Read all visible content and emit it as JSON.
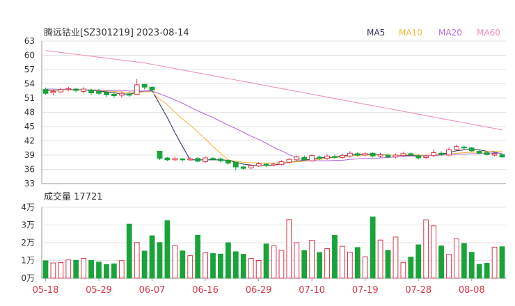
{
  "header": {
    "title": "腾远钴业[SZ301219] 2023-08-14"
  },
  "legend": [
    {
      "label": "MA5",
      "color": "#333366"
    },
    {
      "label": "MA10",
      "color": "#f5b942"
    },
    {
      "label": "MA20",
      "color": "#b56ee0"
    },
    {
      "label": "MA60",
      "color": "#f090c0"
    }
  ],
  "volume_label": "成交量 17721",
  "colors": {
    "up": "#d9344a",
    "down": "#1aa33a",
    "grid": "#e3e3e3",
    "axis": "#555555",
    "date": "#d9344a"
  },
  "chart_data": [
    {
      "type": "candlestick",
      "title": "腾远钴业[SZ301219] 2023-08-14",
      "ylim": [
        33,
        63
      ],
      "yticks": [
        "63",
        "60",
        "57",
        "54",
        "51",
        "48",
        "45",
        "42",
        "39",
        "36",
        "33"
      ],
      "x": [
        "05-18",
        "05-19",
        "05-22",
        "05-23",
        "05-24",
        "05-25",
        "05-26",
        "05-29",
        "05-30",
        "05-31",
        "06-01",
        "06-02",
        "06-05",
        "06-06",
        "06-07",
        "06-08",
        "06-09",
        "06-12",
        "06-13",
        "06-14",
        "06-15",
        "06-16",
        "06-19",
        "06-20",
        "06-21",
        "06-26",
        "06-27",
        "06-28",
        "06-29",
        "06-30",
        "07-03",
        "07-04",
        "07-05",
        "07-06",
        "07-07",
        "07-10",
        "07-11",
        "07-12",
        "07-13",
        "07-14",
        "07-17",
        "07-18",
        "07-19",
        "07-20",
        "07-21",
        "07-24",
        "07-25",
        "07-26",
        "07-27",
        "07-28",
        "07-31",
        "08-01",
        "08-02",
        "08-03",
        "08-04",
        "08-07",
        "08-08",
        "08-09",
        "08-10",
        "08-11",
        "08-14"
      ],
      "xtick_labels": [
        "05-18",
        "05-29",
        "06-07",
        "06-16",
        "06-29",
        "07-10",
        "07-19",
        "07-28",
        "08-08"
      ],
      "xtick_index": [
        0,
        7,
        14,
        21,
        28,
        35,
        42,
        49,
        56
      ],
      "candles": [
        [
          52.8,
          52.0,
          53.2,
          51.7
        ],
        [
          52.1,
          52.4,
          52.8,
          51.6
        ],
        [
          52.3,
          52.8,
          53.2,
          52.1
        ],
        [
          52.8,
          53.0,
          53.4,
          52.5
        ],
        [
          52.9,
          52.6,
          53.1,
          52.2
        ],
        [
          52.4,
          52.9,
          53.3,
          52.0
        ],
        [
          52.7,
          52.1,
          53.0,
          51.6
        ],
        [
          52.4,
          52.0,
          52.9,
          51.6
        ],
        [
          52.2,
          51.7,
          52.5,
          51.2
        ],
        [
          51.8,
          51.5,
          52.3,
          51.1
        ],
        [
          51.6,
          52.0,
          52.4,
          51.1
        ],
        [
          51.9,
          51.6,
          52.3,
          51.2
        ],
        [
          51.8,
          53.8,
          55.0,
          51.8
        ],
        [
          53.9,
          53.3,
          54.0,
          52.8
        ],
        [
          53.3,
          52.7,
          53.5,
          52.2
        ],
        [
          39.8,
          38.3,
          39.8,
          38.0
        ],
        [
          38.4,
          38.0,
          38.6,
          37.7
        ],
        [
          38.0,
          38.3,
          38.7,
          37.8
        ],
        [
          38.2,
          38.0,
          38.4,
          37.7
        ],
        [
          38.0,
          38.2,
          38.5,
          37.8
        ],
        [
          38.3,
          37.7,
          38.6,
          37.5
        ],
        [
          37.6,
          38.4,
          38.7,
          37.3
        ],
        [
          38.3,
          38.1,
          38.6,
          37.9
        ],
        [
          38.2,
          37.8,
          38.5,
          37.4
        ],
        [
          37.9,
          37.3,
          38.1,
          37.0
        ],
        [
          37.5,
          36.5,
          37.6,
          35.8
        ],
        [
          36.5,
          36.2,
          36.8,
          35.9
        ],
        [
          36.3,
          36.8,
          37.0,
          36.0
        ],
        [
          36.7,
          37.2,
          37.5,
          36.5
        ],
        [
          37.1,
          36.8,
          37.3,
          36.5
        ],
        [
          36.9,
          37.1,
          37.4,
          36.6
        ],
        [
          37.0,
          37.6,
          37.9,
          36.8
        ],
        [
          37.5,
          38.1,
          38.4,
          37.2
        ],
        [
          38.0,
          38.6,
          38.9,
          37.7
        ],
        [
          38.5,
          38.0,
          38.9,
          37.8
        ],
        [
          37.8,
          38.9,
          39.2,
          37.6
        ],
        [
          38.6,
          38.3,
          38.9,
          38.0
        ],
        [
          38.3,
          38.8,
          39.2,
          38.0
        ],
        [
          38.7,
          38.5,
          39.1,
          38.2
        ],
        [
          38.5,
          38.9,
          39.3,
          38.2
        ],
        [
          38.8,
          39.4,
          39.8,
          38.5
        ],
        [
          39.3,
          39.0,
          39.6,
          38.7
        ],
        [
          39.0,
          39.3,
          39.7,
          38.7
        ],
        [
          39.4,
          38.8,
          39.6,
          38.5
        ],
        [
          38.8,
          39.1,
          39.5,
          38.5
        ],
        [
          39.0,
          38.6,
          39.4,
          38.3
        ],
        [
          38.6,
          39.0,
          39.3,
          38.3
        ],
        [
          38.9,
          39.3,
          39.7,
          38.6
        ],
        [
          39.3,
          39.0,
          39.6,
          38.7
        ],
        [
          38.9,
          38.4,
          39.2,
          38.1
        ],
        [
          38.5,
          38.8,
          39.1,
          38.2
        ],
        [
          38.9,
          39.5,
          40.2,
          38.6
        ],
        [
          39.4,
          39.1,
          39.8,
          38.8
        ],
        [
          39.0,
          40.1,
          40.6,
          38.8
        ],
        [
          40.2,
          40.8,
          41.2,
          39.8
        ],
        [
          40.7,
          40.5,
          41.0,
          40.2
        ],
        [
          40.5,
          39.9,
          40.7,
          39.6
        ],
        [
          39.8,
          39.4,
          40.1,
          39.2
        ],
        [
          39.5,
          39.1,
          39.7,
          38.9
        ],
        [
          39.0,
          39.3,
          39.6,
          38.7
        ],
        [
          39.1,
          38.6,
          39.3,
          38.4
        ]
      ],
      "ma": {
        "MA5": [
          52.6,
          52.6,
          52.7,
          52.7,
          52.7,
          52.7,
          52.6,
          52.5,
          52.3,
          52.1,
          51.9,
          51.8,
          52.2,
          52.5,
          52.6,
          49.7,
          46.9,
          43.7,
          40.8,
          38.0,
          38.0,
          38.0,
          38.0,
          38.0,
          37.9,
          37.5,
          37.1,
          36.9,
          36.8,
          36.8,
          36.9,
          37.2,
          37.5,
          37.7,
          37.9,
          38.2,
          38.4,
          38.5,
          38.6,
          38.8,
          39.0,
          39.1,
          39.2,
          39.1,
          39.1,
          39.0,
          39.0,
          38.9,
          38.9,
          38.9,
          38.9,
          39.0,
          39.2,
          39.5,
          39.9,
          40.1,
          40.2,
          40.1,
          39.8,
          39.6,
          39.3
        ],
        "MA10": [
          52.7,
          52.7,
          52.7,
          52.7,
          52.7,
          52.7,
          52.7,
          52.6,
          52.5,
          52.4,
          52.3,
          52.2,
          52.2,
          52.3,
          52.3,
          50.7,
          49.6,
          48.0,
          46.6,
          45.3,
          43.9,
          42.4,
          40.8,
          39.4,
          38.0,
          37.7,
          37.5,
          37.4,
          37.3,
          37.3,
          37.3,
          37.4,
          37.5,
          37.6,
          37.7,
          37.9,
          38.1,
          38.3,
          38.5,
          38.6,
          38.8,
          38.9,
          39.0,
          39.0,
          39.0,
          39.0,
          39.0,
          39.0,
          39.1,
          39.0,
          39.0,
          39.0,
          39.1,
          39.2,
          39.4,
          39.5,
          39.6,
          39.6,
          39.7,
          39.8,
          39.8
        ],
        "MA20": [
          52.9,
          52.9,
          52.8,
          52.8,
          52.8,
          52.8,
          52.7,
          52.7,
          52.6,
          52.6,
          52.6,
          52.5,
          52.5,
          52.5,
          52.5,
          51.9,
          51.3,
          50.6,
          49.9,
          49.1,
          48.3,
          47.6,
          46.9,
          46.1,
          45.3,
          44.6,
          43.8,
          43.0,
          42.3,
          41.5,
          40.6,
          39.9,
          39.1,
          38.5,
          37.9,
          37.8,
          37.8,
          37.8,
          37.9,
          37.9,
          38.1,
          38.2,
          38.3,
          38.3,
          38.4,
          38.5,
          38.6,
          38.7,
          38.8,
          38.8,
          38.9,
          38.9,
          39.0,
          39.1,
          39.2,
          39.2,
          39.3,
          39.3,
          39.4,
          39.4,
          39.4
        ],
        "MA60": [
          61.0,
          60.8,
          60.6,
          60.4,
          60.2,
          60.0,
          59.8,
          59.6,
          59.4,
          59.2,
          59.0,
          58.8,
          58.6,
          58.4,
          58.1,
          57.8,
          57.5,
          57.2,
          56.9,
          56.6,
          56.3,
          56.0,
          55.7,
          55.4,
          55.1,
          54.8,
          54.5,
          54.2,
          53.9,
          53.6,
          53.3,
          53.0,
          52.7,
          52.4,
          52.1,
          51.8,
          51.5,
          51.2,
          50.9,
          50.6,
          50.3,
          50.0,
          49.7,
          49.4,
          49.1,
          48.8,
          48.5,
          48.2,
          47.9,
          47.6,
          47.3,
          47.0,
          46.7,
          46.4,
          46.1,
          45.8,
          45.5,
          45.2,
          44.9,
          44.6,
          44.3
        ]
      }
    },
    {
      "type": "bar",
      "title": "成交量 17721",
      "ylim": [
        0,
        40000
      ],
      "yticks": [
        "4万",
        "3万",
        "2万",
        "1万",
        "0万"
      ],
      "values": [
        9800,
        8600,
        8800,
        10300,
        10100,
        11200,
        10000,
        9100,
        7700,
        8100,
        9900,
        30500,
        20100,
        15300,
        23900,
        20100,
        32500,
        18400,
        15400,
        12700,
        24200,
        14300,
        13900,
        13600,
        20000,
        14900,
        13500,
        11200,
        10000,
        19300,
        18200,
        15700,
        33000,
        20000,
        15600,
        21300,
        14500,
        16700,
        24100,
        18000,
        14700,
        17300,
        12100,
        34500,
        21500,
        15700,
        23200,
        8900,
        11900,
        18800,
        32900,
        29500,
        18200,
        13400,
        22200,
        19600,
        14600,
        7800,
        8400,
        17500,
        17721
      ]
    }
  ]
}
